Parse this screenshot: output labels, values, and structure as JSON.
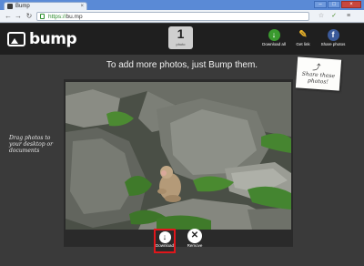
{
  "browser": {
    "tab_title": "Bump",
    "tab_close": "×",
    "url_protocol": "https://",
    "url_host": "bu.mp",
    "window_controls": [
      "–",
      "□",
      "×"
    ],
    "nav": {
      "back": "←",
      "forward": "→",
      "reload": "↻"
    },
    "extensions": [
      "☆",
      "✓",
      "≡"
    ]
  },
  "header": {
    "logo_text": "bump",
    "photo_count": "1",
    "photo_count_label": "photo",
    "actions": [
      {
        "label": "Download all",
        "icon": "download-icon",
        "color": "#3a9a2e"
      },
      {
        "label": "Get link",
        "icon": "link-icon",
        "color": "#e8b12a"
      },
      {
        "label": "Share photos",
        "icon": "facebook-icon",
        "color": "#3b5a9a"
      }
    ]
  },
  "main": {
    "headline": "To add more photos, just Bump them.",
    "sticky_note": "Share these photos!",
    "drag_hint": "Drag photos to your desktop or documents",
    "photo_actions": {
      "download_label": "Download",
      "remove_label": "Remove"
    }
  },
  "colors": {
    "header_bg": "#1f1f1f",
    "page_bg": "#3a3a3a",
    "highlight": "#e0161b"
  }
}
